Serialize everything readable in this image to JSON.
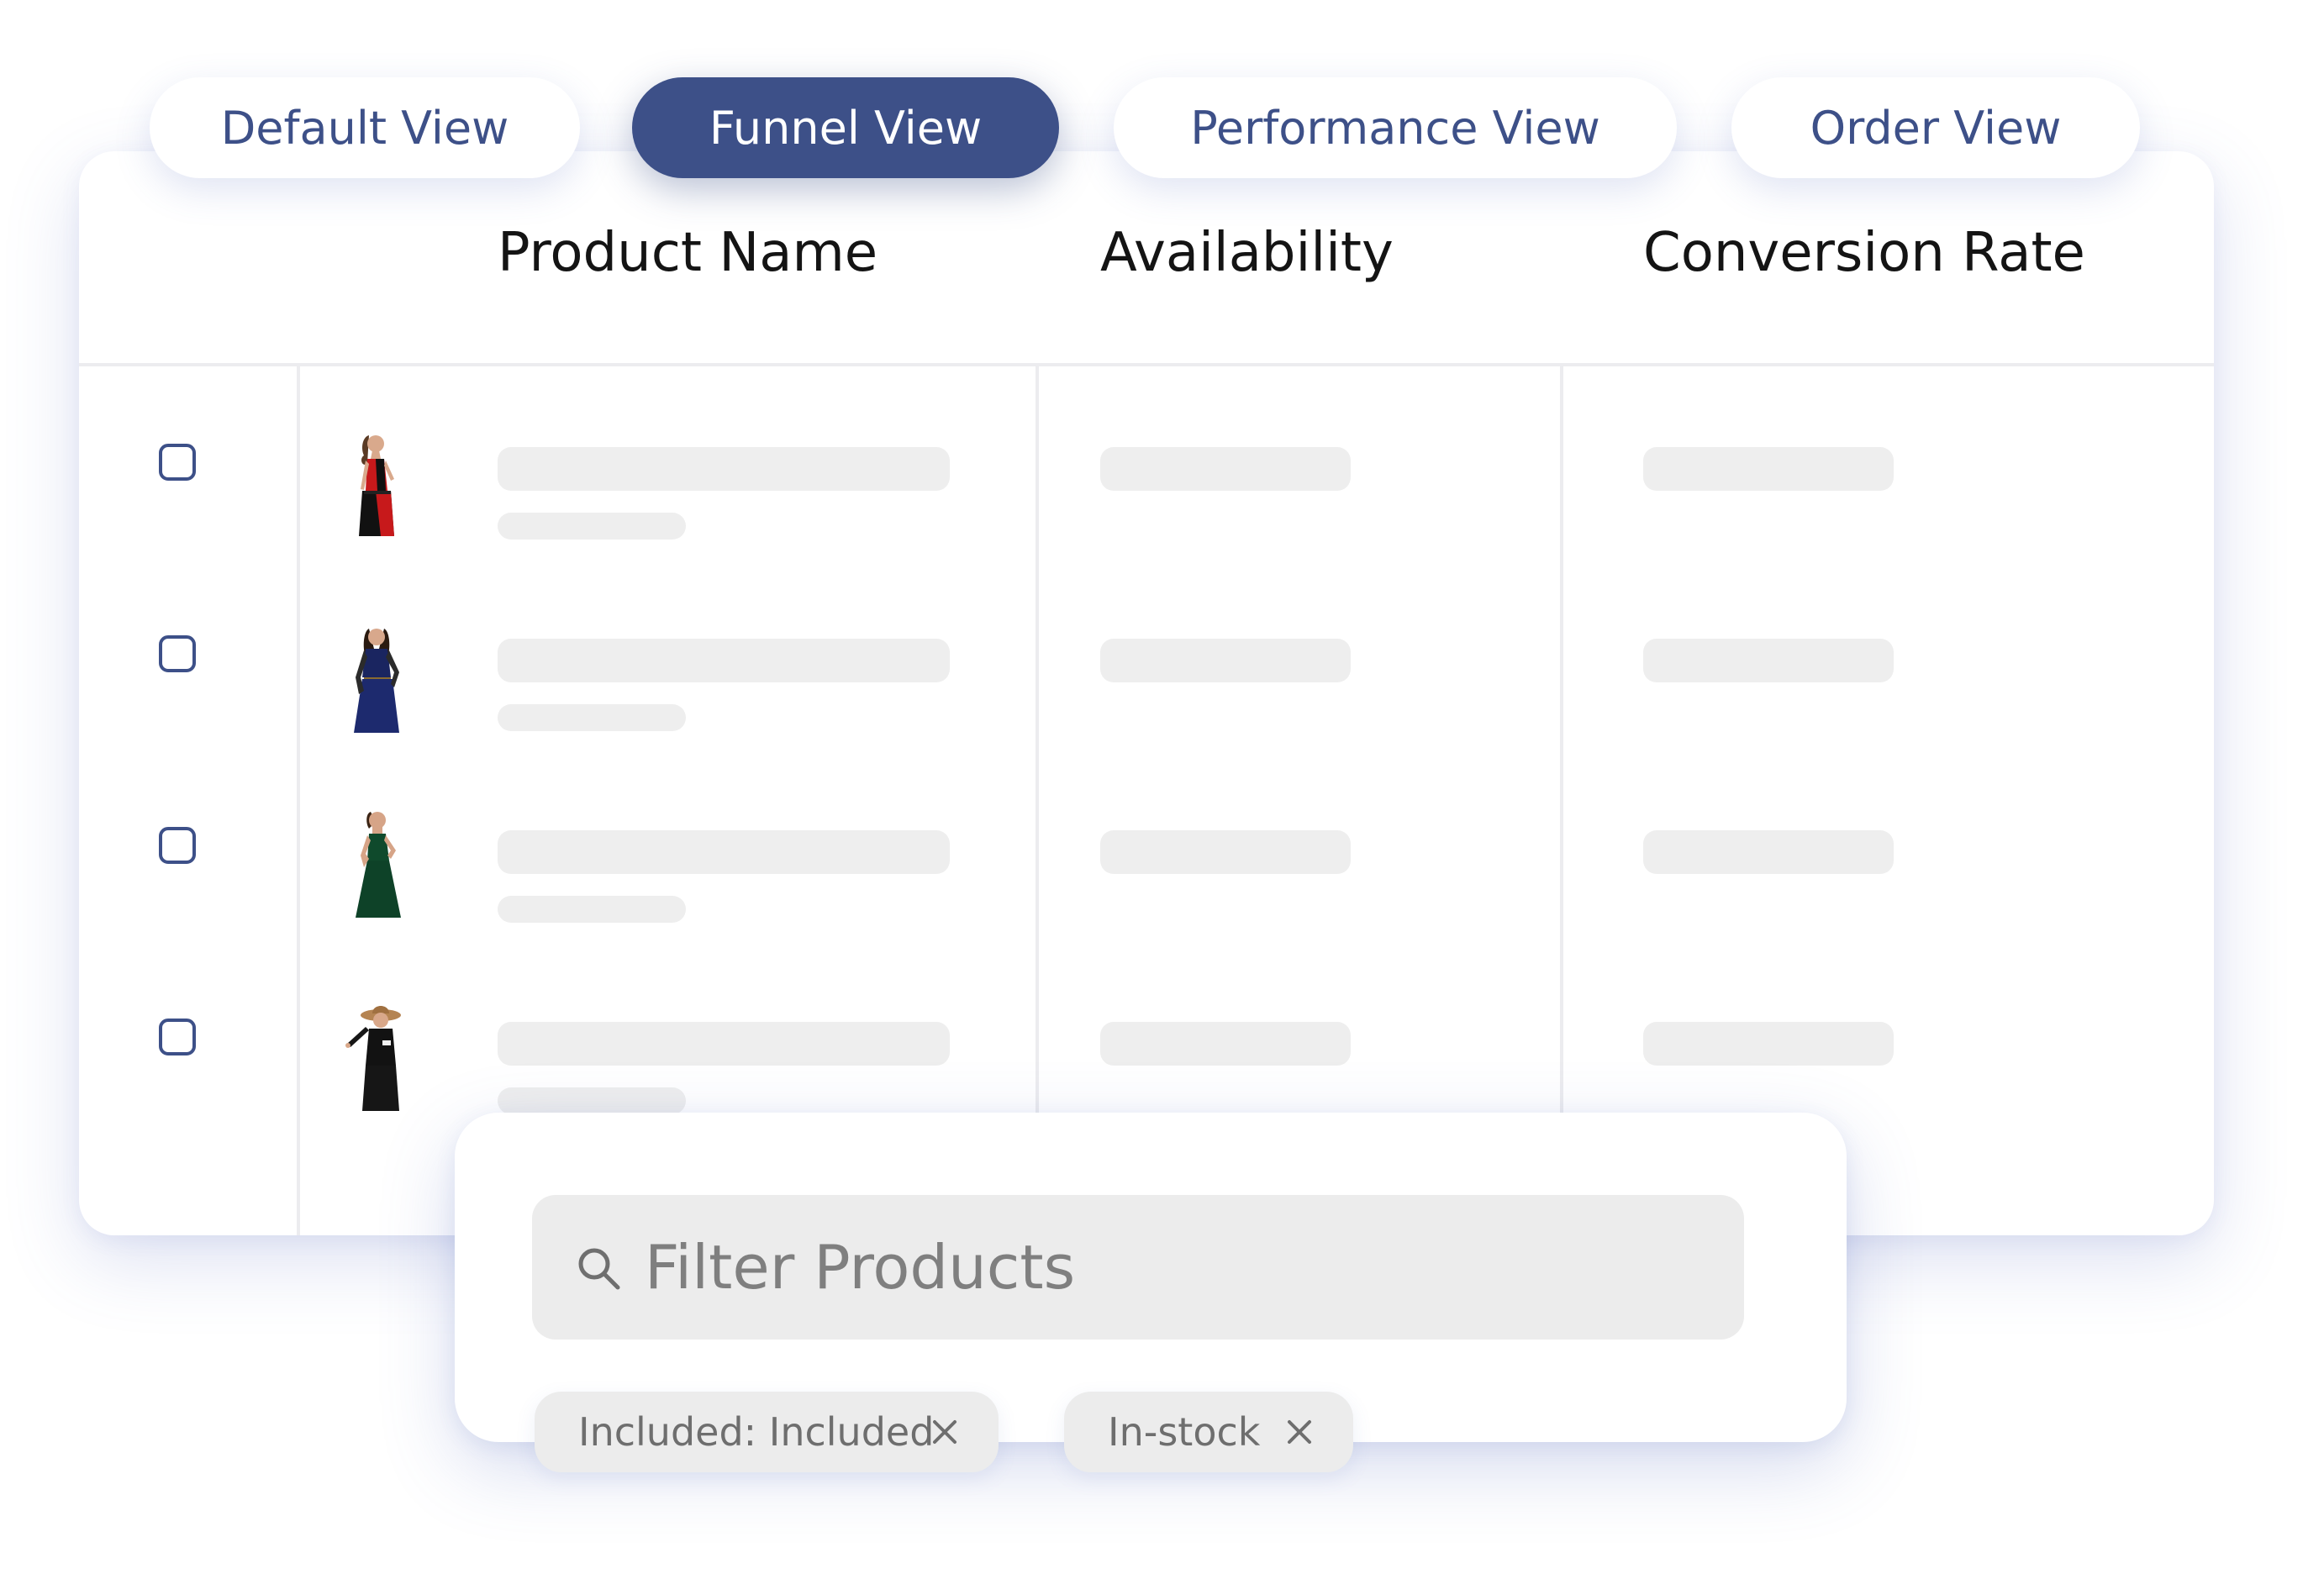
{
  "tabs": [
    {
      "label": "Default View",
      "active": false
    },
    {
      "label": "Funnel View",
      "active": true
    },
    {
      "label": "Performance View",
      "active": false
    },
    {
      "label": "Order View",
      "active": false
    }
  ],
  "table": {
    "columns": [
      "Product Name",
      "Availability",
      "Conversion Rate"
    ],
    "rows": [
      {
        "checked": false,
        "thumbnail": "red-black-dress-model",
        "state": "loading"
      },
      {
        "checked": false,
        "thumbnail": "navy-lace-dress-model",
        "state": "loading"
      },
      {
        "checked": false,
        "thumbnail": "green-dress-model",
        "state": "loading"
      },
      {
        "checked": false,
        "thumbnail": "black-dress-hat-model",
        "state": "loading"
      }
    ]
  },
  "filter": {
    "placeholder": "Filter Products",
    "search_icon": "search-icon",
    "chips": [
      {
        "label": "Included: Included",
        "icon": "close-icon"
      },
      {
        "label": "In-stock",
        "icon": "close-icon"
      }
    ]
  },
  "colors": {
    "accent": "#3d5088",
    "skeleton": "#eeeeee",
    "chip_bg": "#ececec"
  }
}
